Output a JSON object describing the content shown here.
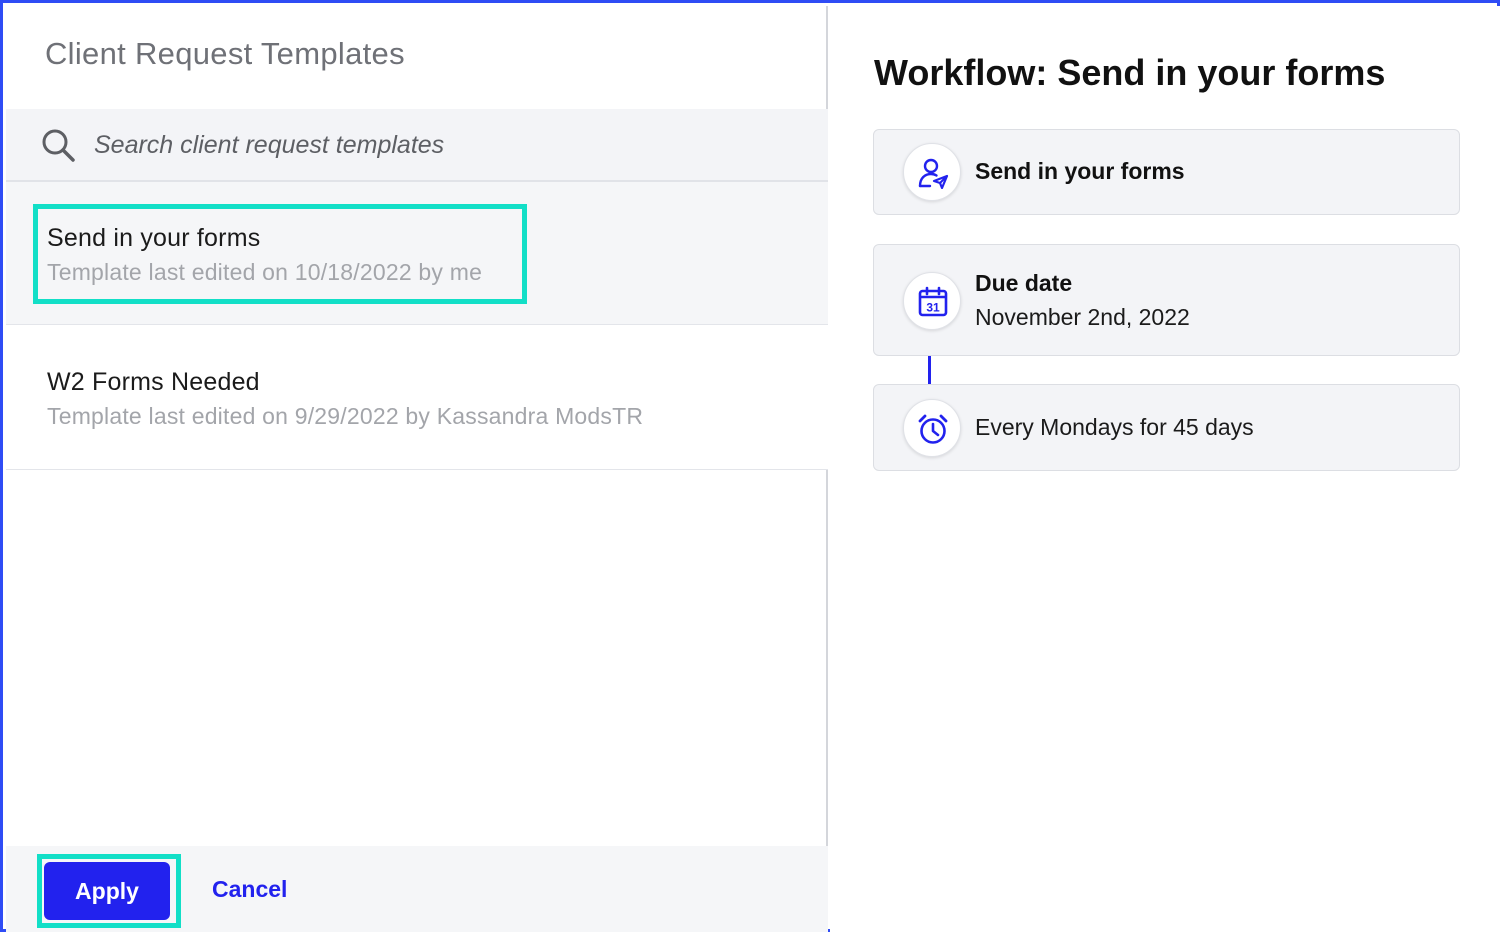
{
  "left_panel": {
    "title": "Client Request Templates",
    "search": {
      "placeholder": "Search client request templates",
      "value": ""
    },
    "templates": [
      {
        "title": "Send in your forms",
        "subtitle": "Template last edited on 10/18/2022 by me",
        "selected": true
      },
      {
        "title": "W2 Forms Needed",
        "subtitle": "Template last edited on 9/29/2022 by Kassandra ModsTR",
        "selected": false
      }
    ],
    "footer": {
      "apply_label": "Apply",
      "cancel_label": "Cancel"
    }
  },
  "right_panel": {
    "title": "Workflow: Send in your forms",
    "steps": [
      {
        "icon": "user-send-icon",
        "label": "Send in your forms"
      },
      {
        "icon": "calendar-icon",
        "calendar_day": "31",
        "label": "Due date",
        "value": "November 2nd, 2022"
      },
      {
        "icon": "alarm-clock-icon",
        "label": "Every Mondays for 45 days"
      }
    ]
  },
  "colors": {
    "accent": "#2222ee",
    "highlight": "#12dfc7",
    "frame": "#2f4cf5",
    "panel_bg": "#f3f4f7"
  }
}
